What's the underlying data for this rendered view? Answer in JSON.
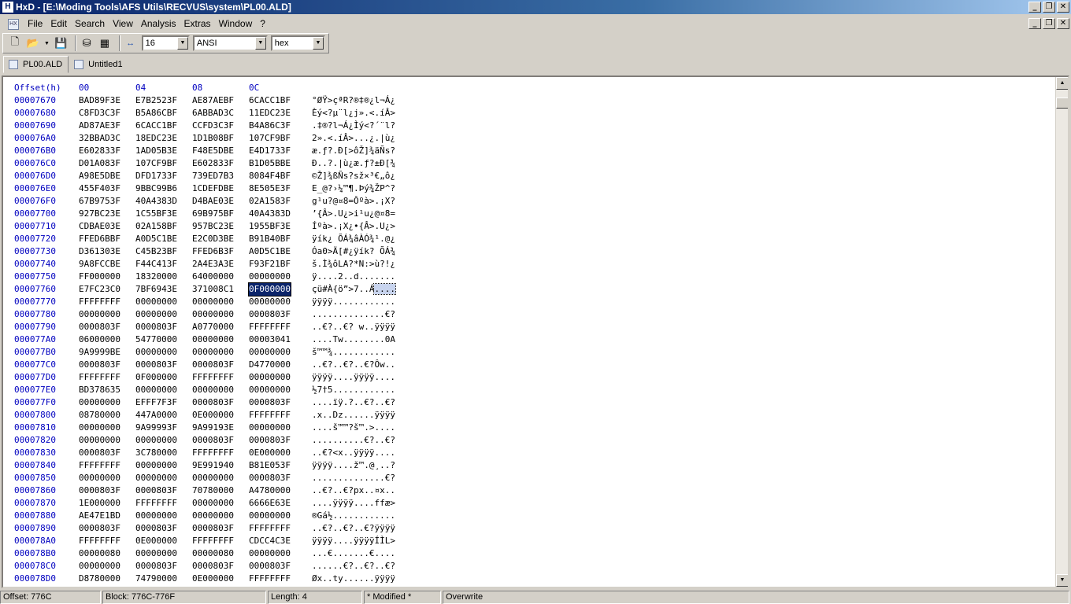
{
  "window": {
    "title": "HxD - [E:\\Moding Tools\\AFS Utils\\RECVUS\\system\\PL00.ALD]"
  },
  "menu": [
    "File",
    "Edit",
    "Search",
    "View",
    "Analysis",
    "Extras",
    "Window",
    "?"
  ],
  "toolbar": {
    "bytes_per_row": "16",
    "charset": "ANSI",
    "offset_base": "hex"
  },
  "tabs": [
    {
      "label": "PL00.ALD",
      "active": true
    },
    {
      "label": "Untitled1",
      "active": false
    }
  ],
  "hex": {
    "header": {
      "offset": "Offset(h)",
      "cols": [
        "00",
        "04",
        "08",
        "0C"
      ]
    },
    "rows": [
      {
        "off": "00007670",
        "g": [
          "BAD89F3E",
          "E7B2523F",
          "AE87AEBF",
          "6CACC1BF"
        ],
        "t": "°ØŸ>çªR?®‡®¿l¬Á¿"
      },
      {
        "off": "00007680",
        "g": [
          "C8FD3C3F",
          "B5A86CBF",
          "6ABBAD3C",
          "11EDC23E"
        ],
        "t": "Èý<?µ¨l¿j».<.íÂ>"
      },
      {
        "off": "00007690",
        "g": [
          "AD87AE3F",
          "6CACC1BF",
          "CCFD3C3F",
          "B4A86C3F"
        ],
        "t": ".‡®?l¬Á¿Ìý<?´¨l?"
      },
      {
        "off": "000076A0",
        "g": [
          "32BBAD3C",
          "18EDC23E",
          "1D1B08BF",
          "107CF9BF"
        ],
        "t": "2».<.íÂ>...¿.|ù¿"
      },
      {
        "off": "000076B0",
        "g": [
          "E602833F",
          "1AD05B3E",
          "F48E5DBE",
          "E4D1733F"
        ],
        "t": "æ.ƒ?.Ð[>ôŽ]¾äÑs?"
      },
      {
        "off": "000076C0",
        "g": [
          "D01A083F",
          "107CF9BF",
          "E602833F",
          "B1D05BBE"
        ],
        "t": "Ð..?.|ù¿æ.ƒ?±Ð[¾"
      },
      {
        "off": "000076D0",
        "g": [
          "A98E5DBE",
          "DFD1733F",
          "739ED7B3",
          "8084F4BF"
        ],
        "t": "©Ž]¾ßÑs?sž×³€„ô¿"
      },
      {
        "off": "000076E0",
        "g": [
          "455F403F",
          "9BBC99B6",
          "1CDEFDBE",
          "8E505E3F"
        ],
        "t": "E_@?›¼™¶.Þý¾ŽP^?"
      },
      {
        "off": "000076F0",
        "g": [
          "67B9753F",
          "40A4383D",
          "D4BAE03E",
          "02A1583F"
        ],
        "t": "g¹u?@¤8=Ôºà>.¡X?"
      },
      {
        "off": "00007700",
        "g": [
          "927BC23E",
          "1C55BF3E",
          "69B975BF",
          "40A4383D"
        ],
        "t": "’{Â>.U¿>i¹u¿@¤8="
      },
      {
        "off": "00007710",
        "g": [
          "CDBAE03E",
          "02A158BF",
          "957BC23E",
          "1955BF3E"
        ],
        "t": "Íºà>.¡X¿•{Â>.U¿>"
      },
      {
        "off": "00007720",
        "g": [
          "FFED6BBF",
          "A0D5C1BE",
          "E2C0D3BE",
          "B91B40BF"
        ],
        "t": "ÿík¿ ÕÁ¾âÀÓ¾¹.@¿"
      },
      {
        "off": "00007730",
        "g": [
          "D361303E",
          "C45B23BF",
          "FFED6B3F",
          "A0D5C1BE"
        ],
        "t": "Óa0>Ä[#¿ÿík? ÕÁ¾"
      },
      {
        "off": "00007740",
        "g": [
          "9A8FCCBE",
          "F44C413F",
          "2A4E3A3E",
          "F93F21BF"
        ],
        "t": "š.Ì¾ôLA?*N:>ù?!¿"
      },
      {
        "off": "00007750",
        "g": [
          "FF000000",
          "18320000",
          "64000000",
          "00000000"
        ],
        "t": "ÿ....2..d......."
      },
      {
        "off": "00007760",
        "g": [
          "E7FC23C0",
          "7BF6943E",
          "371008C1",
          "0F000000"
        ],
        "t": "çü#À{ö”>7..Á....",
        "sel": 3
      },
      {
        "off": "00007770",
        "g": [
          "FFFFFFFF",
          "00000000",
          "00000000",
          "00000000"
        ],
        "t": "ÿÿÿÿ............"
      },
      {
        "off": "00007780",
        "g": [
          "00000000",
          "00000000",
          "00000000",
          "0000803F"
        ],
        "t": "..............€?"
      },
      {
        "off": "00007790",
        "g": [
          "0000803F",
          "0000803F",
          "A0770000",
          "FFFFFFFF"
        ],
        "t": "..€?..€? w..ÿÿÿÿ"
      },
      {
        "off": "000077A0",
        "g": [
          "06000000",
          "54770000",
          "00000000",
          "00003041"
        ],
        "t": "....Tw........0A"
      },
      {
        "off": "000077B0",
        "g": [
          "9A9999BE",
          "00000000",
          "00000000",
          "00000000"
        ],
        "t": "š™™¾............"
      },
      {
        "off": "000077C0",
        "g": [
          "0000803F",
          "0000803F",
          "0000803F",
          "D4770000"
        ],
        "t": "..€?..€?..€?Ôw.."
      },
      {
        "off": "000077D0",
        "g": [
          "FFFFFFFF",
          "0F000000",
          "FFFFFFFF",
          "00000000"
        ],
        "t": "ÿÿÿÿ....ÿÿÿÿ...."
      },
      {
        "off": "000077E0",
        "g": [
          "BD378635",
          "00000000",
          "00000000",
          "00000000"
        ],
        "t": "½7†5............"
      },
      {
        "off": "000077F0",
        "g": [
          "00000000",
          "EFFF7F3F",
          "0000803F",
          "0000803F"
        ],
        "t": "....ïÿ.?..€?..€?"
      },
      {
        "off": "00007800",
        "g": [
          "08780000",
          "447A0000",
          "0E000000",
          "FFFFFFFF"
        ],
        "t": ".x..Dz......ÿÿÿÿ"
      },
      {
        "off": "00007810",
        "g": [
          "00000000",
          "9A99993F",
          "9A99193E",
          "00000000"
        ],
        "t": "....š™™?š™.>...."
      },
      {
        "off": "00007820",
        "g": [
          "00000000",
          "00000000",
          "0000803F",
          "0000803F"
        ],
        "t": "..........€?..€?"
      },
      {
        "off": "00007830",
        "g": [
          "0000803F",
          "3C780000",
          "FFFFFFFF",
          "0E000000"
        ],
        "t": "..€?<x..ÿÿÿÿ...."
      },
      {
        "off": "00007840",
        "g": [
          "FFFFFFFF",
          "00000000",
          "9E991940",
          "B81E053F"
        ],
        "t": "ÿÿÿÿ....ž™.@¸..?"
      },
      {
        "off": "00007850",
        "g": [
          "00000000",
          "00000000",
          "00000000",
          "0000803F"
        ],
        "t": "..............€?"
      },
      {
        "off": "00007860",
        "g": [
          "0000803F",
          "0000803F",
          "70780000",
          "A4780000"
        ],
        "t": "..€?..€?px..¤x.."
      },
      {
        "off": "00007870",
        "g": [
          "1E000000",
          "FFFFFFFF",
          "00000000",
          "6666E63E"
        ],
        "t": "....ÿÿÿÿ....ffæ>"
      },
      {
        "off": "00007880",
        "g": [
          "AE47E1BD",
          "00000000",
          "00000000",
          "00000000"
        ],
        "t": "®Gá½............"
      },
      {
        "off": "00007890",
        "g": [
          "0000803F",
          "0000803F",
          "0000803F",
          "FFFFFFFF"
        ],
        "t": "..€?..€?..€?ÿÿÿÿ"
      },
      {
        "off": "000078A0",
        "g": [
          "FFFFFFFF",
          "0E000000",
          "FFFFFFFF",
          "CDCC4C3E"
        ],
        "t": "ÿÿÿÿ....ÿÿÿÿÍÌL>"
      },
      {
        "off": "000078B0",
        "g": [
          "00000080",
          "00000000",
          "00000080",
          "00000000"
        ],
        "t": "...€.......€...."
      },
      {
        "off": "000078C0",
        "g": [
          "00000000",
          "0000803F",
          "0000803F",
          "0000803F"
        ],
        "t": "......€?..€?..€?"
      },
      {
        "off": "000078D0",
        "g": [
          "D8780000",
          "74790000",
          "0E000000",
          "FFFFFFFF"
        ],
        "t": "Øx..ty......ÿÿÿÿ"
      }
    ]
  },
  "status": {
    "offset": "Offset: 776C",
    "block": "Block: 776C-776F",
    "length": "Length: 4",
    "modified": "* Modified *",
    "mode": "Overwrite"
  },
  "icons": {
    "new": "new-file-icon",
    "open": "open-folder-icon",
    "save": "save-icon",
    "disk": "disk-editor-icon",
    "ram": "ram-editor-icon",
    "columns": "bytes-per-row-icon"
  }
}
